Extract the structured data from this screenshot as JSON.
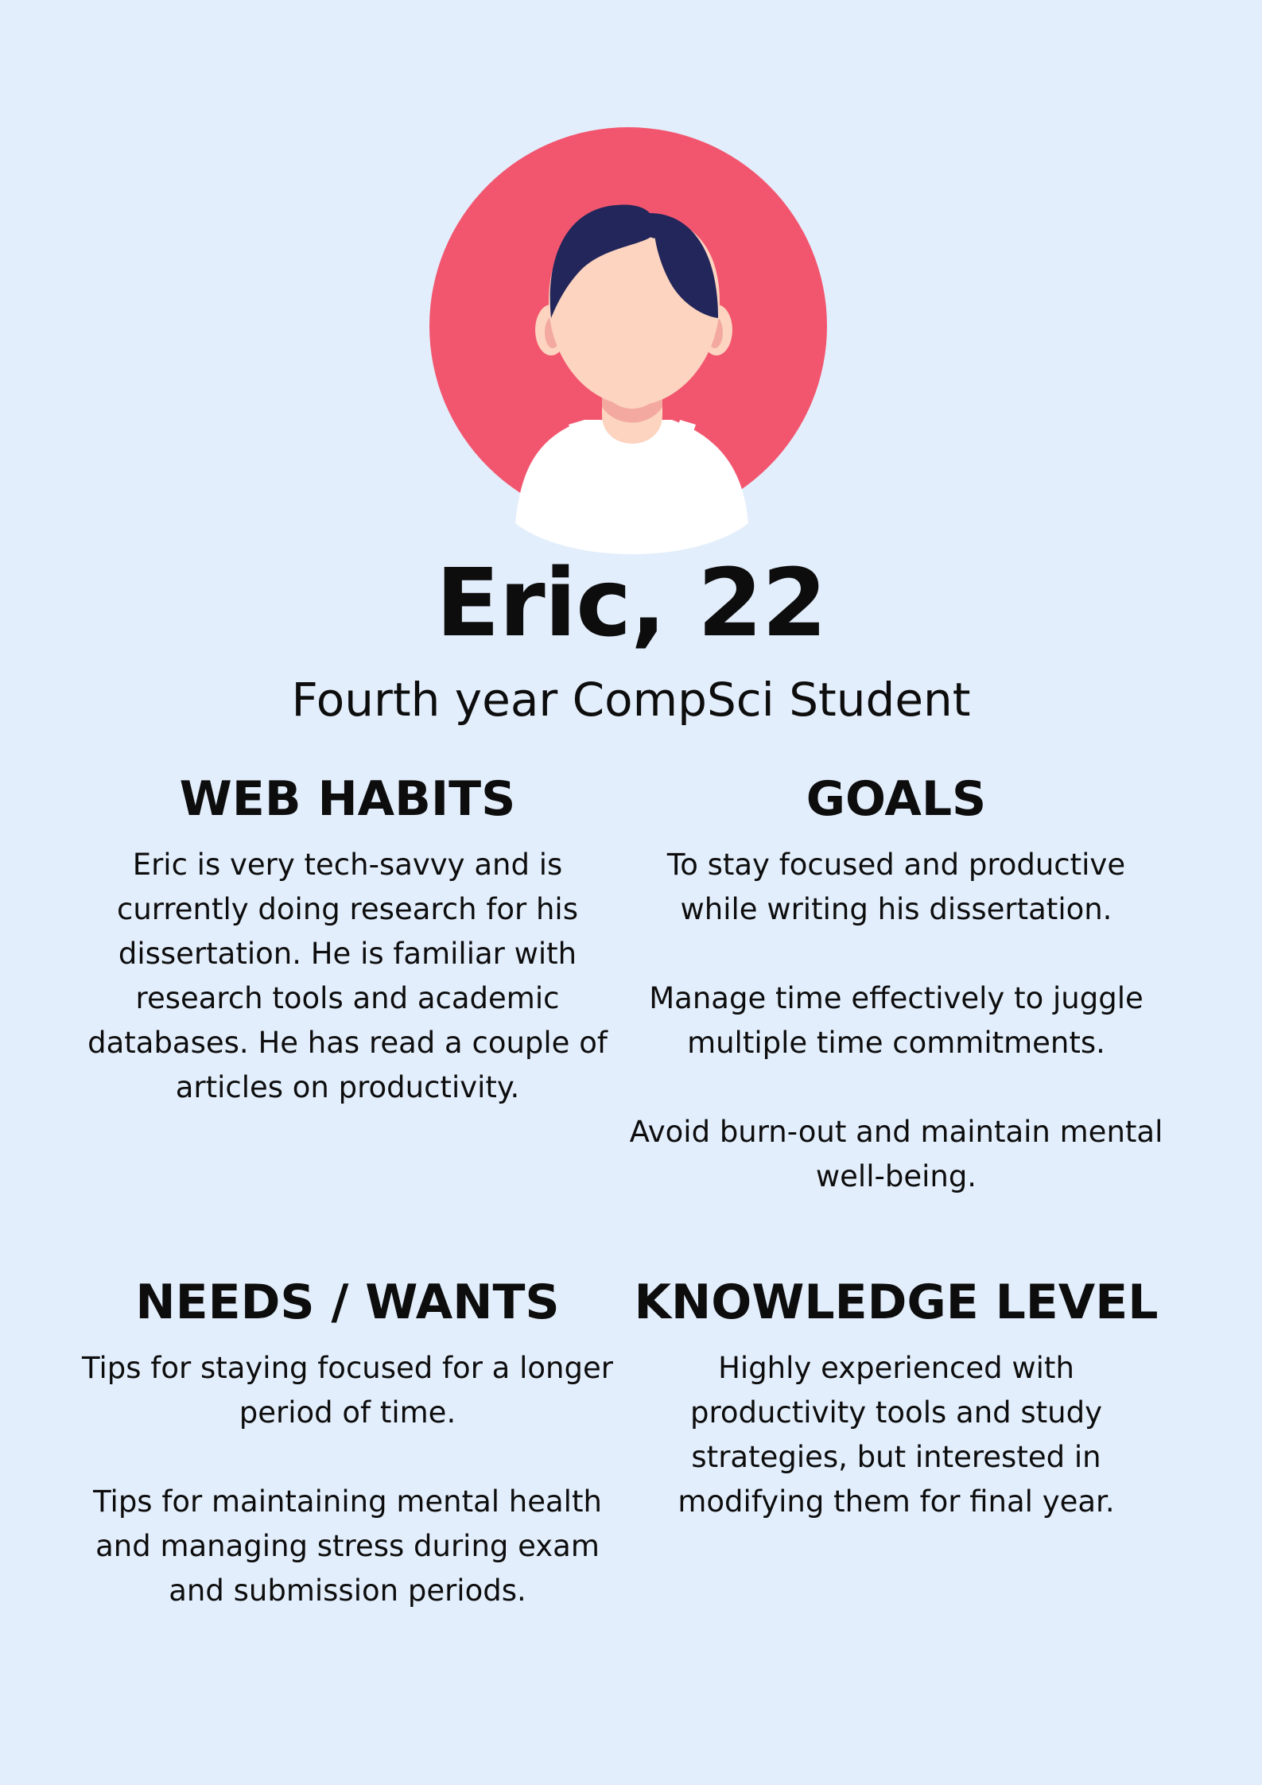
{
  "persona": {
    "name": "Eric, 22",
    "subtitle": "Fourth year CompSci Student"
  },
  "sections": {
    "web_habits": {
      "heading": "WEB HABITS",
      "paragraphs": [
        "Eric is very tech-savvy and is currently doing research for his dissertation. He is familiar with research tools and academic databases. He has read a couple of articles on productivity."
      ]
    },
    "goals": {
      "heading": "GOALS",
      "paragraphs": [
        "To stay focused and productive while writing his dissertation.",
        "Manage time effectively to juggle multiple time commitments.",
        "Avoid burn-out and maintain mental well-being."
      ]
    },
    "needs_wants": {
      "heading": "NEEDS / WANTS",
      "paragraphs": [
        "Tips for staying focused for a longer period of time.",
        "Tips for maintaining mental health and managing stress during exam and submission periods."
      ]
    },
    "knowledge_level": {
      "heading": "KNOWLEDGE LEVEL",
      "paragraphs": [
        "Highly experienced with productivity tools and study strategies, but interested in modifying them for final year."
      ]
    }
  },
  "colors": {
    "background": "#e3eefc",
    "avatar_circle": "#f2566f",
    "hair": "#23265a",
    "skin": "#fcd4c0",
    "shirt": "#ffffff"
  },
  "icons": {
    "avatar": "person-avatar-icon"
  }
}
